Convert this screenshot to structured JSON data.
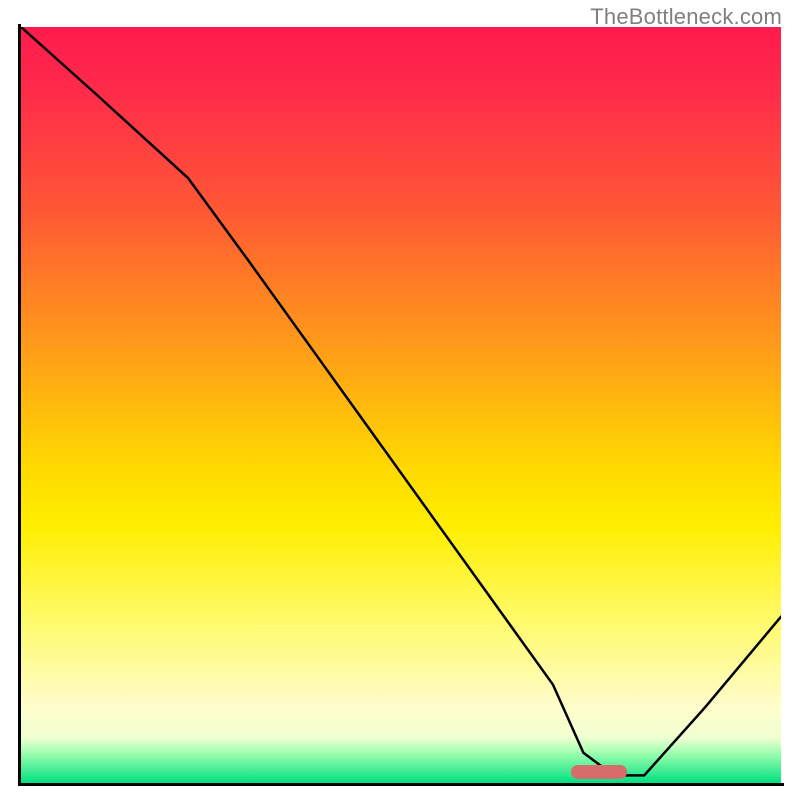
{
  "watermark": "TheBottleneck.com",
  "marker": {
    "x_frac": 0.76,
    "y_frac": 0.985
  },
  "chart_data": {
    "type": "line",
    "title": "",
    "xlabel": "",
    "ylabel": "",
    "xlim": [
      0,
      100
    ],
    "ylim": [
      0,
      100
    ],
    "series": [
      {
        "name": "curve",
        "x": [
          0,
          10,
          22,
          30,
          40,
          50,
          60,
          70,
          74,
          78,
          82,
          90,
          100
        ],
        "values": [
          100,
          91,
          80,
          69,
          55,
          41,
          27,
          13,
          4,
          1,
          1,
          10,
          22
        ]
      }
    ],
    "annotations": [
      {
        "name": "highlight-bar",
        "x": 78,
        "y": 1
      }
    ]
  }
}
